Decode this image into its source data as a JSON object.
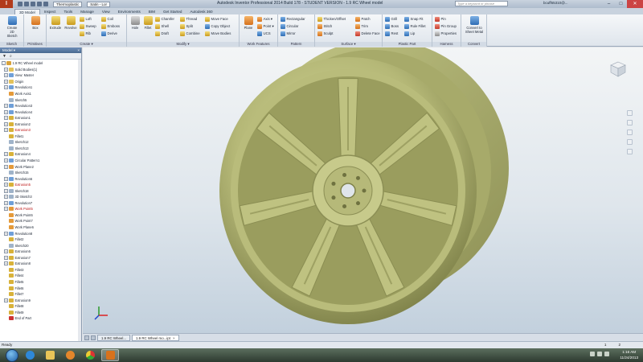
{
  "window": {
    "app_button": "I",
    "material": "Thermoplastic",
    "appearance": "Satin - Lor",
    "title": "Autodesk Inventor Professional 2014 Build 178 - STUDENT VERSION - 1.9 RC Wheel model",
    "search_placeholder": "Type a keyword or phrase",
    "user": "bcuff65310@...",
    "min": "–",
    "max": "□",
    "close": "✕"
  },
  "ribbon_tabs": [
    "3D Model",
    "Inspect",
    "Tools",
    "Manage",
    "View",
    "Environments",
    "BIM",
    "Get Started",
    "Autodesk 360"
  ],
  "ribbon": {
    "sketch": {
      "name": "Sketch",
      "create_2d": "Create 2D Sketch"
    },
    "primitives": {
      "name": "Primitives",
      "box": "Box"
    },
    "create": {
      "name": "Create ▾",
      "extrude": "Extrude",
      "revolve": "Revolve",
      "loft": "Loft",
      "sweep": "Sweep",
      "rib": "Rib",
      "coil": "Coil",
      "emboss": "Emboss",
      "derive": "Derive"
    },
    "modify": {
      "name": "Modify ▾",
      "hole": "Hole",
      "fillet": "Fillet",
      "chamfer": "Chamfer",
      "shell": "Shell",
      "draft": "Draft",
      "thread": "Thread",
      "split": "Split",
      "combine": "Combine",
      "move_face": "Move Face",
      "copy_object": "Copy Object",
      "move_bodies": "Move Bodies"
    },
    "work_features": {
      "name": "Work Features",
      "plane": "Plane",
      "axis": "Axis ▾",
      "point": "Point ▾",
      "ucs": "UCS"
    },
    "pattern": {
      "name": "Pattern",
      "rectangular": "Rectangular",
      "circular": "Circular",
      "mirror": "Mirror"
    },
    "surface": {
      "name": "Surface ▾",
      "thicken": "Thicken/Offset",
      "stitch": "Stitch",
      "sculpt": "Sculpt",
      "patch": "Patch",
      "trim": "Trim",
      "delete_face": "Delete Face"
    },
    "plastic_part": {
      "name": "Plastic Part",
      "grill": "Grill",
      "boss": "Boss",
      "rest": "Rest",
      "snap_fit": "Snap Fit",
      "rule_fillet": "Rule Fillet",
      "lip": "Lip"
    },
    "harness": {
      "name": "Harness",
      "pin": "Pin",
      "pin_group": "Pin Group",
      "properties": "Properties"
    },
    "convert": {
      "name": "Convert",
      "sheet_metal": "Convert to Sheet Metal"
    }
  },
  "browser": {
    "title": "Model ▾",
    "items": [
      {
        "label": "1.9 RC Wheel model",
        "icon": "part",
        "indent": 0,
        "expand": "-"
      },
      {
        "label": "Solid Bodies(1)",
        "icon": "folder",
        "indent": 1,
        "expand": "+"
      },
      {
        "label": "View: Master",
        "icon": "view",
        "indent": 1,
        "expand": "+"
      },
      {
        "label": "Origin",
        "icon": "folder",
        "indent": 1,
        "expand": "+"
      },
      {
        "label": "Revolution1",
        "icon": "revolve",
        "indent": 1,
        "expand": "+"
      },
      {
        "label": "Work Axis1",
        "icon": "workaxis",
        "indent": 1,
        "expand": ""
      },
      {
        "label": "Sketch5",
        "icon": "sketch",
        "indent": 1,
        "expand": ""
      },
      {
        "label": "Revolution3",
        "icon": "revolve",
        "indent": 1,
        "expand": "+"
      },
      {
        "label": "Revolution4",
        "icon": "revolve",
        "indent": 1,
        "expand": "+"
      },
      {
        "label": "Extrusion1",
        "icon": "extrude",
        "indent": 1,
        "expand": "+"
      },
      {
        "label": "Extrusion2",
        "icon": "extrude",
        "indent": 1,
        "expand": "+"
      },
      {
        "label": "Extrusion3",
        "icon": "extrude-err",
        "indent": 1,
        "expand": "+",
        "error": true
      },
      {
        "label": "Fillet1",
        "icon": "fillet",
        "indent": 1,
        "expand": ""
      },
      {
        "label": "Sketch12",
        "icon": "sketch",
        "indent": 1,
        "expand": ""
      },
      {
        "label": "Sketch13",
        "icon": "sketch",
        "indent": 1,
        "expand": ""
      },
      {
        "label": "Extrusion4",
        "icon": "extrude",
        "indent": 1,
        "expand": "+"
      },
      {
        "label": "Circular Pattern1",
        "icon": "pattern",
        "indent": 1,
        "expand": "+"
      },
      {
        "label": "Work Plane2",
        "icon": "workplane",
        "indent": 1,
        "expand": "+"
      },
      {
        "label": "Sketch15",
        "icon": "sketch",
        "indent": 1,
        "expand": ""
      },
      {
        "label": "Revolution6",
        "icon": "revolve",
        "indent": 1,
        "expand": "+"
      },
      {
        "label": "Extrusion5",
        "icon": "extrude-err",
        "indent": 1,
        "expand": "+",
        "error": true
      },
      {
        "label": "Sketch18",
        "icon": "sketch",
        "indent": 1,
        "expand": "+"
      },
      {
        "label": "3D Sketch3",
        "icon": "sketch3d",
        "indent": 1,
        "expand": "+"
      },
      {
        "label": "Revolution7",
        "icon": "revolve",
        "indent": 1,
        "expand": "+"
      },
      {
        "label": "Work Point5",
        "icon": "workpoint-err",
        "indent": 1,
        "expand": "+",
        "error": true
      },
      {
        "label": "Work Point6",
        "icon": "workpoint",
        "indent": 1,
        "expand": ""
      },
      {
        "label": "Work Point7",
        "icon": "workpoint",
        "indent": 1,
        "expand": ""
      },
      {
        "label": "Work Plane6",
        "icon": "workplane",
        "indent": 1,
        "expand": ""
      },
      {
        "label": "Revolution8",
        "icon": "revolve",
        "indent": 1,
        "expand": "+"
      },
      {
        "label": "Fillet2",
        "icon": "fillet",
        "indent": 1,
        "expand": ""
      },
      {
        "label": "Sketch20",
        "icon": "sketch",
        "indent": 1,
        "expand": ""
      },
      {
        "label": "Extrusion6",
        "icon": "extrude",
        "indent": 1,
        "expand": "+"
      },
      {
        "label": "Extrusion7",
        "icon": "extrude",
        "indent": 1,
        "expand": "+"
      },
      {
        "label": "Extrusion8",
        "icon": "extrude",
        "indent": 1,
        "expand": "+"
      },
      {
        "label": "Fillet3",
        "icon": "fillet",
        "indent": 1,
        "expand": ""
      },
      {
        "label": "Fillet4",
        "icon": "fillet",
        "indent": 1,
        "expand": ""
      },
      {
        "label": "Fillet5",
        "icon": "fillet",
        "indent": 1,
        "expand": ""
      },
      {
        "label": "Fillet6",
        "icon": "fillet",
        "indent": 1,
        "expand": ""
      },
      {
        "label": "Fillet7",
        "icon": "fillet",
        "indent": 1,
        "expand": ""
      },
      {
        "label": "Extrusion9",
        "icon": "extrude",
        "indent": 1,
        "expand": "+"
      },
      {
        "label": "Fillet8",
        "icon": "fillet",
        "indent": 1,
        "expand": ""
      },
      {
        "label": "Fillet9",
        "icon": "fillet",
        "indent": 1,
        "expand": ""
      },
      {
        "label": "End of Part",
        "icon": "endofpart",
        "indent": 1,
        "expand": ""
      }
    ]
  },
  "model_color": "#bfc281",
  "doc_tabs": [
    "1.9 RC Wheel...",
    "1.9 RC Wheel mo...ipt"
  ],
  "status": {
    "text": "Ready",
    "count_left": "1",
    "count_right": "2"
  },
  "clock": {
    "time": "1:16 AM",
    "date": "11/24/2013"
  }
}
